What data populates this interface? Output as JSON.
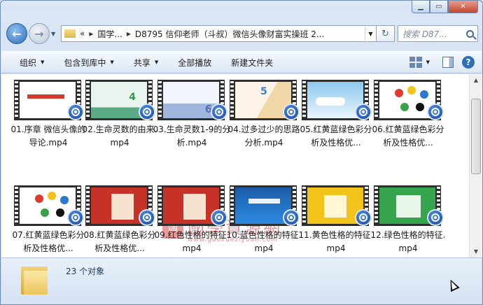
{
  "address": {
    "overflow": "«",
    "segments": [
      "国学...",
      "D8795 信仰老师（斗叔）微信头像财富实操班 2..."
    ]
  },
  "search": {
    "placeholder": "搜索 D87..."
  },
  "toolbar": {
    "organize": "组织",
    "include_library": "包含到库中",
    "share": "共享",
    "play_all": "全部播放",
    "new_folder": "新建文件夹"
  },
  "files": [
    {
      "name": "01.序章 微信头像的导论.mp4",
      "thumb": "white"
    },
    {
      "name": "02.生命灵数的由来.mp4",
      "thumb": "teal"
    },
    {
      "name": "03.生命灵数1-9的分析.mp4",
      "thumb": "blue"
    },
    {
      "name": "04.过多过少的思路分析.mp4",
      "thumb": "orange"
    },
    {
      "name": "05.红黄蓝绿色彩分析及性格优...",
      "thumb": "sky"
    },
    {
      "name": "06.红黄蓝绿色彩分析及性格优...",
      "thumb": "dots"
    },
    {
      "name": "07.红黄蓝绿色彩分析及性格优...",
      "thumb": "dots"
    },
    {
      "name": "08.红黄蓝绿色彩分析及性格优...",
      "thumb": "red"
    },
    {
      "name": "09.红色性格的特征.mp4",
      "thumb": "red"
    },
    {
      "name": "10.蓝色性格的特征.mp4",
      "thumb": "ocean"
    },
    {
      "name": "11.黄色性格的特征.mp4",
      "thumb": "yellow"
    },
    {
      "name": "12.绿色性格的特征.mp4",
      "thumb": "green"
    }
  ],
  "status": {
    "count_text": "23 个对象"
  },
  "watermark": {
    "text": "國學資源網",
    "url": "www.guoxueziyuan.com",
    "seal": "国"
  },
  "colors": {
    "accent": "#2f6fb8",
    "statusbar": "#d5e2f2",
    "close": "#c5452e"
  }
}
